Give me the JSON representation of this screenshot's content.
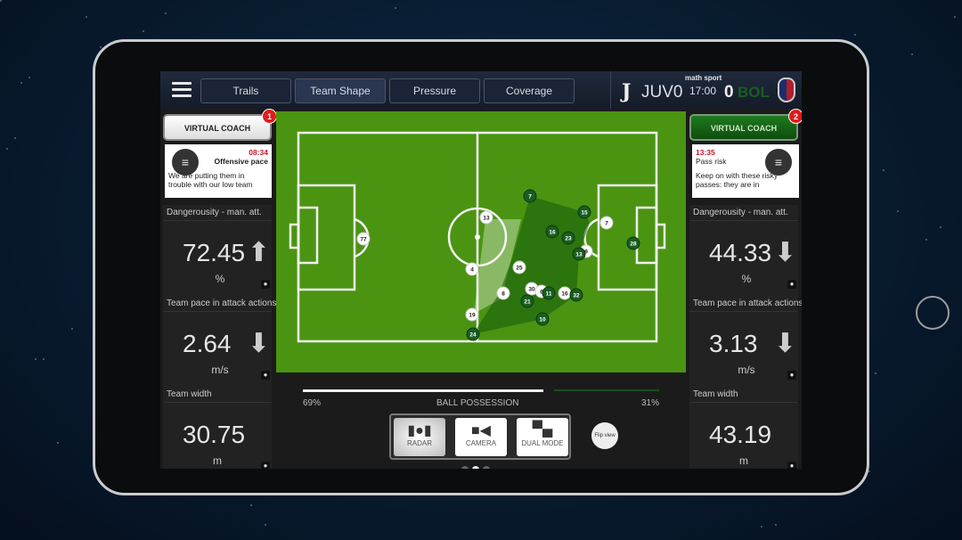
{
  "topbar": {
    "tabs": [
      {
        "label": "Trails"
      },
      {
        "label": "Team Shape",
        "active": true
      },
      {
        "label": "Pressure"
      },
      {
        "label": "Coverage"
      }
    ],
    "brand": "math sport",
    "home_team": "JUV",
    "home_score": "0",
    "clock": "17:00",
    "away_score": "0",
    "away_team": "BOL"
  },
  "left": {
    "coach_label": "VIRTUAL COACH",
    "badge": "1",
    "note": {
      "time": "08:34",
      "title": "Offensive pace",
      "text": "We are putting them in trouble with our low team"
    },
    "stats": [
      {
        "label": "Dangerousity - man. att.",
        "value": "72.45",
        "unit": "%",
        "trend": "up"
      },
      {
        "label": "Team pace in attack actions",
        "value": "2.64",
        "unit": "m/s",
        "trend": "down"
      },
      {
        "label": "Team width",
        "value": "30.75",
        "unit": "m"
      }
    ]
  },
  "right": {
    "coach_label": "VIRTUAL COACH",
    "badge": "2",
    "note": {
      "time": "13:35",
      "title": "Pass risk",
      "text": "Keep on with these risky passes: they are in"
    },
    "stats": [
      {
        "label": "Dangerousity - man. att.",
        "value": "44.33",
        "unit": "%",
        "trend": "down"
      },
      {
        "label": "Team pace in attack actions",
        "value": "3.13",
        "unit": "m/s",
        "trend": "down"
      },
      {
        "label": "Team width",
        "value": "43.19",
        "unit": "m"
      }
    ]
  },
  "players": {
    "white": [
      "77",
      "13",
      "4",
      "25",
      "8",
      "30",
      "6",
      "16",
      "19",
      "7",
      "9"
    ],
    "green": [
      "7",
      "15",
      "16",
      "23",
      "13",
      "11",
      "32",
      "21",
      "10",
      "24",
      "28"
    ]
  },
  "possession": {
    "label": "BALL POSSESSION",
    "home": "69%",
    "away": "31%",
    "home_value": 69
  },
  "modes": [
    {
      "label": "RADAR",
      "selected": true
    },
    {
      "label": "CAMERA"
    },
    {
      "label": "DUAL MODE"
    }
  ],
  "flip_label": "Flip view",
  "colors": {
    "pitch": "#4a9412",
    "home": "#ffffff",
    "away": "#1a5d22",
    "alert": "#e01b1b"
  }
}
